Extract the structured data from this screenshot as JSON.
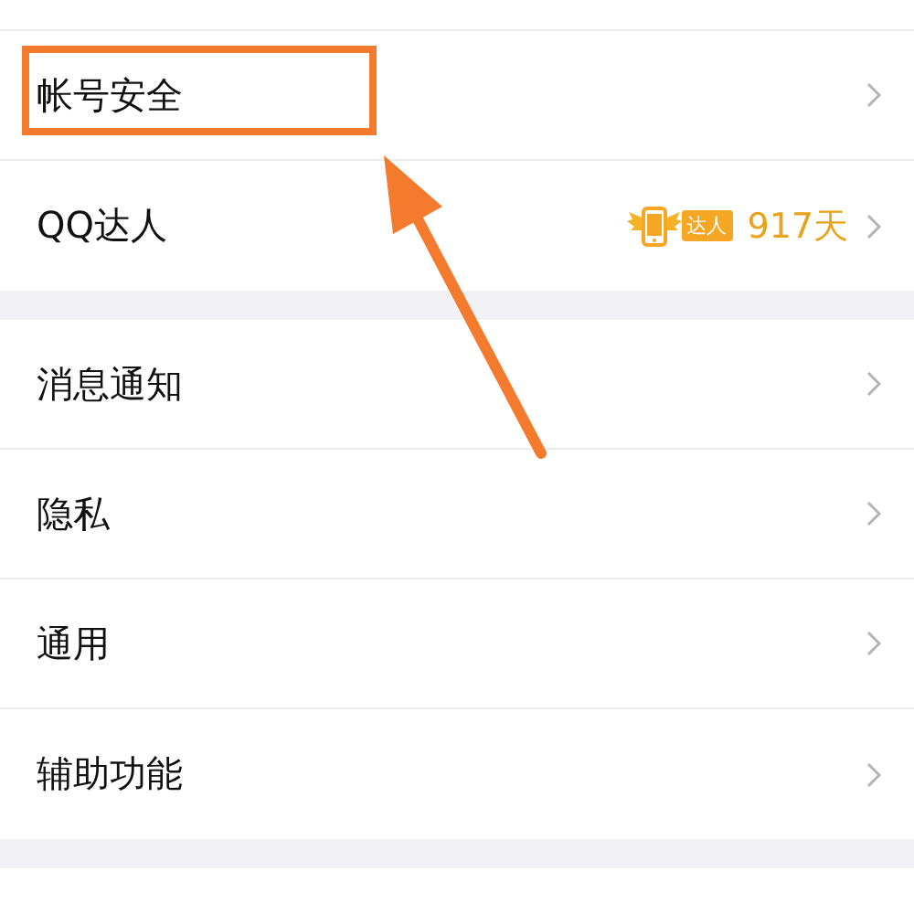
{
  "sections": [
    {
      "rows": [
        {
          "label": "帐号安全",
          "highlighted": true
        },
        {
          "label": "QQ达人",
          "highlighted": false,
          "badge": {
            "tag": "达人",
            "value": "917天"
          }
        }
      ]
    },
    {
      "rows": [
        {
          "label": "消息通知",
          "highlighted": false
        },
        {
          "label": "隐私",
          "highlighted": false
        },
        {
          "label": "通用",
          "highlighted": false
        },
        {
          "label": "辅助功能",
          "highlighted": false
        }
      ]
    }
  ]
}
